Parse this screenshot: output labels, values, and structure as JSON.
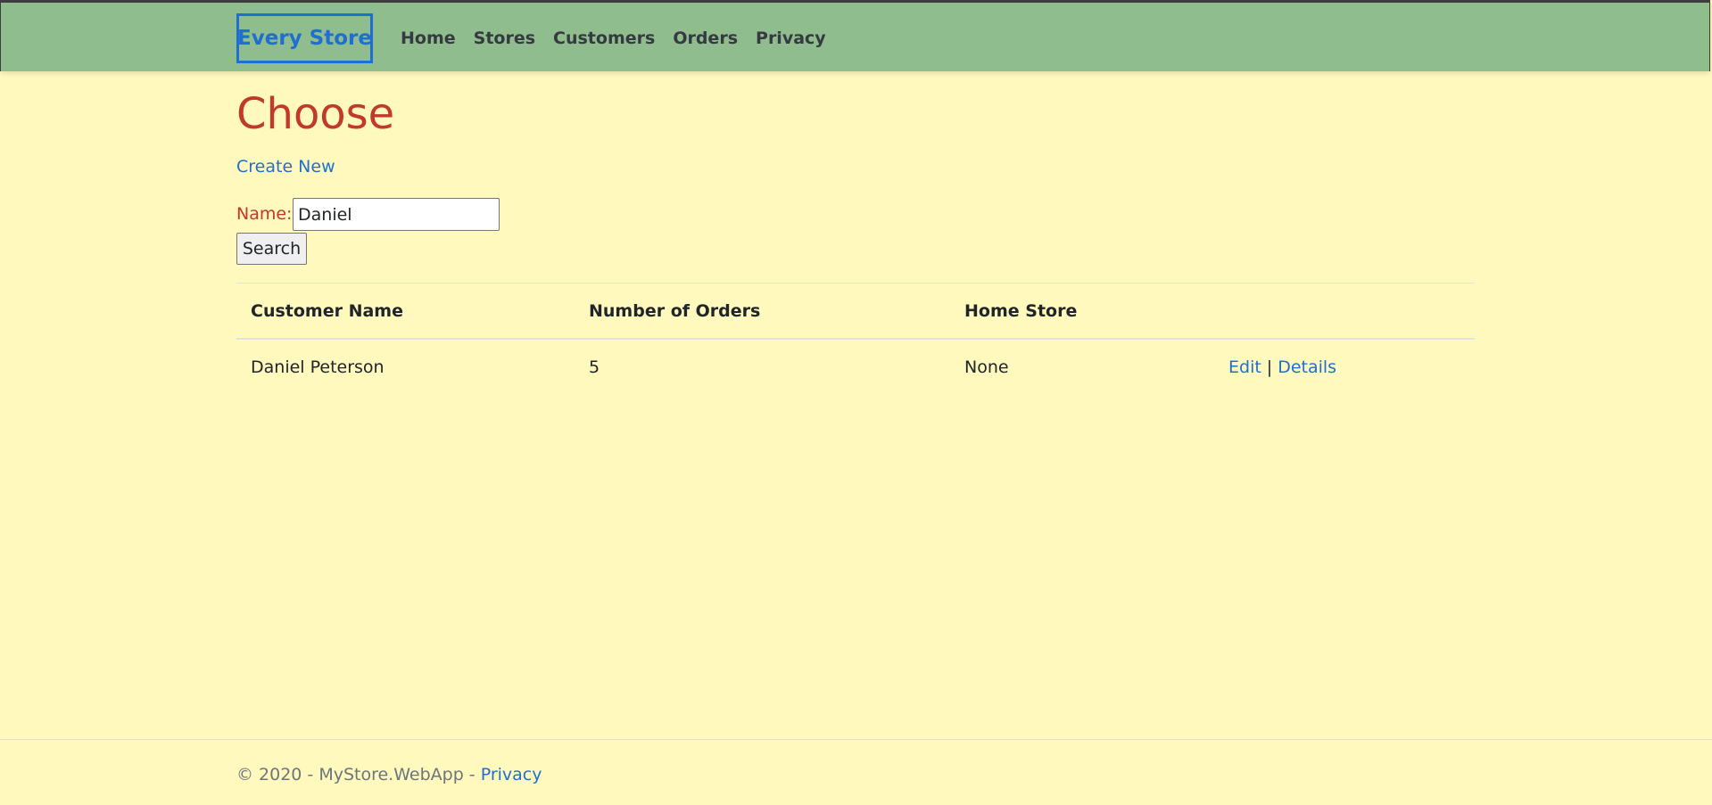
{
  "navbar": {
    "brand": "Every Store",
    "links": [
      "Home",
      "Stores",
      "Customers",
      "Orders",
      "Privacy"
    ]
  },
  "main": {
    "title": "Choose",
    "create_link": "Create New",
    "search": {
      "label": "Name:",
      "value": "Daniel",
      "button": "Search"
    },
    "table": {
      "headers": [
        "Customer Name",
        "Number of Orders",
        "Home Store"
      ],
      "rows": [
        {
          "name": "Daniel Peterson",
          "orders": "5",
          "home_store": "None",
          "edit": "Edit",
          "separator": "|",
          "details": "Details"
        }
      ]
    }
  },
  "footer": {
    "text": "© 2020 - MyStore.WebApp - ",
    "privacy": "Privacy"
  },
  "colors": {
    "background": "#fff9be",
    "navbar": "#8fbd8e",
    "title": "#c0392b",
    "link": "#1e6fd0"
  }
}
